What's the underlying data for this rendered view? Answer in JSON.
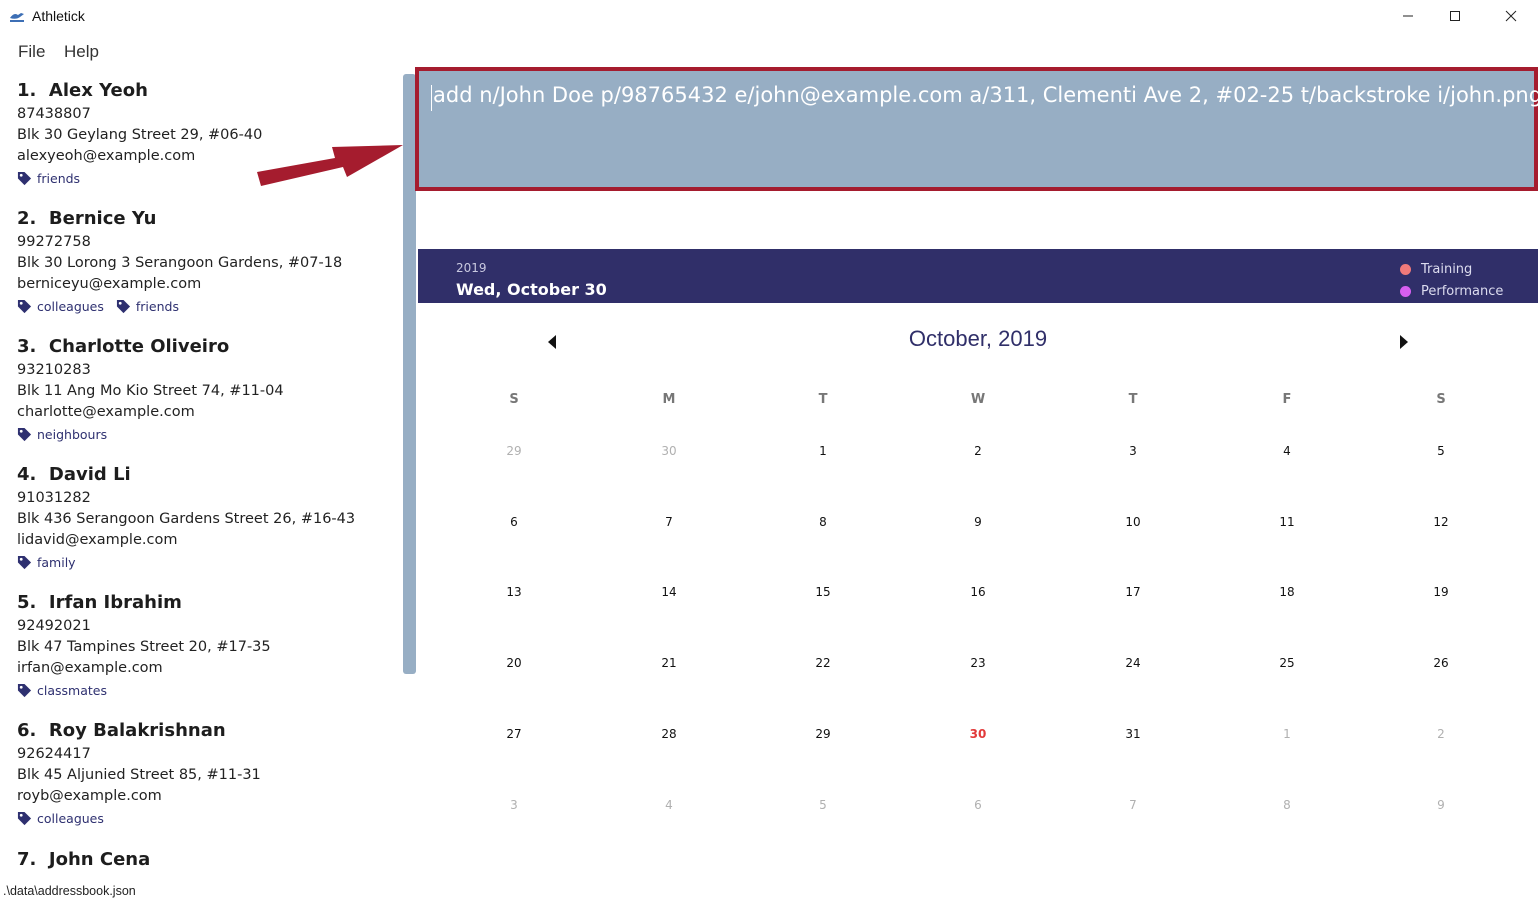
{
  "window": {
    "title": "Athletick",
    "controls": [
      "minimize-icon",
      "maximize-icon",
      "close-icon"
    ]
  },
  "menu": {
    "file": "File",
    "help": "Help"
  },
  "persons": [
    {
      "index": "1.",
      "name": "Alex Yeoh",
      "phone": "87438807",
      "address": "Blk 30 Geylang Street 29, #06-40",
      "email": "alexyeoh@example.com",
      "tags": [
        "friends"
      ]
    },
    {
      "index": "2.",
      "name": "Bernice Yu",
      "phone": "99272758",
      "address": "Blk 30 Lorong 3 Serangoon Gardens, #07-18",
      "email": "berniceyu@example.com",
      "tags": [
        "colleagues",
        "friends"
      ]
    },
    {
      "index": "3.",
      "name": "Charlotte Oliveiro",
      "phone": "93210283",
      "address": "Blk 11 Ang Mo Kio Street 74, #11-04",
      "email": "charlotte@example.com",
      "tags": [
        "neighbours"
      ]
    },
    {
      "index": "4.",
      "name": "David Li",
      "phone": "91031282",
      "address": "Blk 436 Serangoon Gardens Street 26, #16-43",
      "email": "lidavid@example.com",
      "tags": [
        "family"
      ]
    },
    {
      "index": "5.",
      "name": "Irfan Ibrahim",
      "phone": "92492021",
      "address": "Blk 47 Tampines Street 20, #17-35",
      "email": "irfan@example.com",
      "tags": [
        "classmates"
      ]
    },
    {
      "index": "6.",
      "name": "Roy Balakrishnan",
      "phone": "92624417",
      "address": "Blk 45 Aljunied Street 85, #11-31",
      "email": "royb@example.com",
      "tags": [
        "colleagues"
      ]
    },
    {
      "index": "7.",
      "name": "John Cena",
      "phone": "",
      "address": "",
      "email": "",
      "tags": []
    }
  ],
  "status": {
    "file_path": ".\\data\\addressbook.json"
  },
  "command": {
    "text": "add n/John Doe p/98765432 e/john@example.com a/311, Clementi Ave 2, #02-25 t/backstroke i/john.png"
  },
  "calendar": {
    "year": "2019",
    "selected_date": "Wed, October 30",
    "legend": [
      {
        "label": "Training",
        "color": "#f07a7a"
      },
      {
        "label": "Performance",
        "color": "#d65ff0"
      }
    ],
    "month_title": "October, 2019",
    "weekdays": [
      "S",
      "M",
      "T",
      "W",
      "T",
      "F",
      "S"
    ],
    "weeks": [
      [
        {
          "d": "29",
          "m": true
        },
        {
          "d": "30",
          "m": true
        },
        {
          "d": "1"
        },
        {
          "d": "2"
        },
        {
          "d": "3"
        },
        {
          "d": "4"
        },
        {
          "d": "5"
        }
      ],
      [
        {
          "d": "6"
        },
        {
          "d": "7"
        },
        {
          "d": "8"
        },
        {
          "d": "9"
        },
        {
          "d": "10"
        },
        {
          "d": "11"
        },
        {
          "d": "12"
        }
      ],
      [
        {
          "d": "13"
        },
        {
          "d": "14"
        },
        {
          "d": "15"
        },
        {
          "d": "16"
        },
        {
          "d": "17"
        },
        {
          "d": "18"
        },
        {
          "d": "19"
        }
      ],
      [
        {
          "d": "20"
        },
        {
          "d": "21"
        },
        {
          "d": "22"
        },
        {
          "d": "23"
        },
        {
          "d": "24"
        },
        {
          "d": "25"
        },
        {
          "d": "26"
        }
      ],
      [
        {
          "d": "27"
        },
        {
          "d": "28"
        },
        {
          "d": "29"
        },
        {
          "d": "30",
          "today": true
        },
        {
          "d": "31"
        },
        {
          "d": "1",
          "m": true
        },
        {
          "d": "2",
          "m": true
        }
      ],
      [
        {
          "d": "3",
          "m": true
        },
        {
          "d": "4",
          "m": true
        },
        {
          "d": "5",
          "m": true
        },
        {
          "d": "6",
          "m": true
        },
        {
          "d": "7",
          "m": true
        },
        {
          "d": "8",
          "m": true
        },
        {
          "d": "9",
          "m": true
        }
      ]
    ]
  },
  "colors": {
    "accent": "#302f69",
    "command_bg": "#97aec4",
    "highlight_border": "#a51c2e",
    "today": "#e23a3a"
  }
}
